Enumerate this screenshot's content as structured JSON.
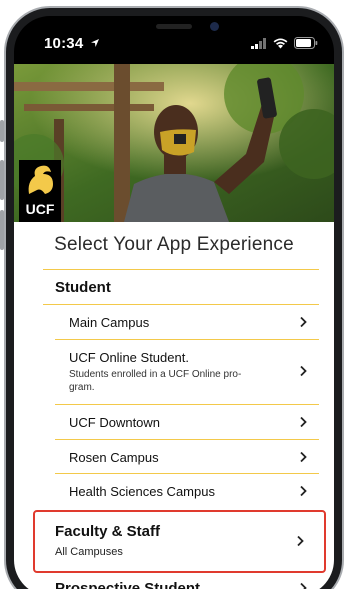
{
  "status_bar": {
    "time": "10:34"
  },
  "hero": {
    "logo_text": "UCF"
  },
  "page": {
    "title": "Select Your App Experience"
  },
  "student": {
    "heading": "Student",
    "items": [
      {
        "label": "Main Campus"
      },
      {
        "label": "UCF Online Student.",
        "sub": "Students enrolled in a UCF Online pro-gram."
      },
      {
        "label": "UCF Downtown"
      },
      {
        "label": "Rosen Campus"
      },
      {
        "label": "Health Sciences Campus"
      }
    ]
  },
  "faculty": {
    "heading": "Faculty & Staff",
    "sub": "All Campuses"
  },
  "prospective": {
    "heading": "Prospective Student"
  },
  "colors": {
    "accent_gold": "#f3c94a",
    "highlight_red": "#e03a2e"
  }
}
